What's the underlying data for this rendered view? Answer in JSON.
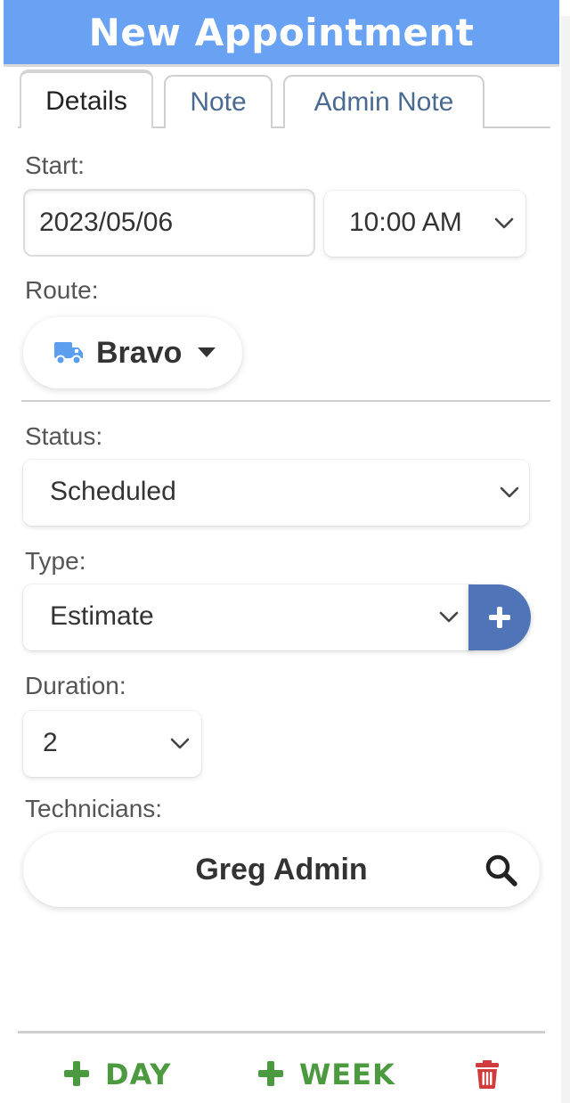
{
  "title": "New Appointment",
  "tabs": [
    {
      "label": "Details",
      "active": true
    },
    {
      "label": "Note",
      "active": false
    },
    {
      "label": "Admin Note",
      "active": false
    }
  ],
  "start": {
    "label": "Start:",
    "date": "2023/05/06",
    "time": "10:00 AM"
  },
  "route": {
    "label": "Route:",
    "value": "Bravo",
    "icon": "truck-icon",
    "icon_color": "#5b9ef0"
  },
  "status": {
    "label": "Status:",
    "value": "Scheduled"
  },
  "type": {
    "label": "Type:",
    "value": "Estimate",
    "add_icon": "plus-icon"
  },
  "duration": {
    "label": "Duration:",
    "value": "2"
  },
  "technicians": {
    "label": "Technicians:",
    "value": "Greg Admin",
    "icon": "search-icon"
  },
  "footer": {
    "day_label": "DAY",
    "week_label": "WEEK",
    "delete_icon": "trash-icon",
    "action_color": "#4c9a3f",
    "delete_color": "#d13b3b"
  },
  "colors": {
    "header": "#6aa2f3",
    "add_button": "#4f74b8"
  }
}
